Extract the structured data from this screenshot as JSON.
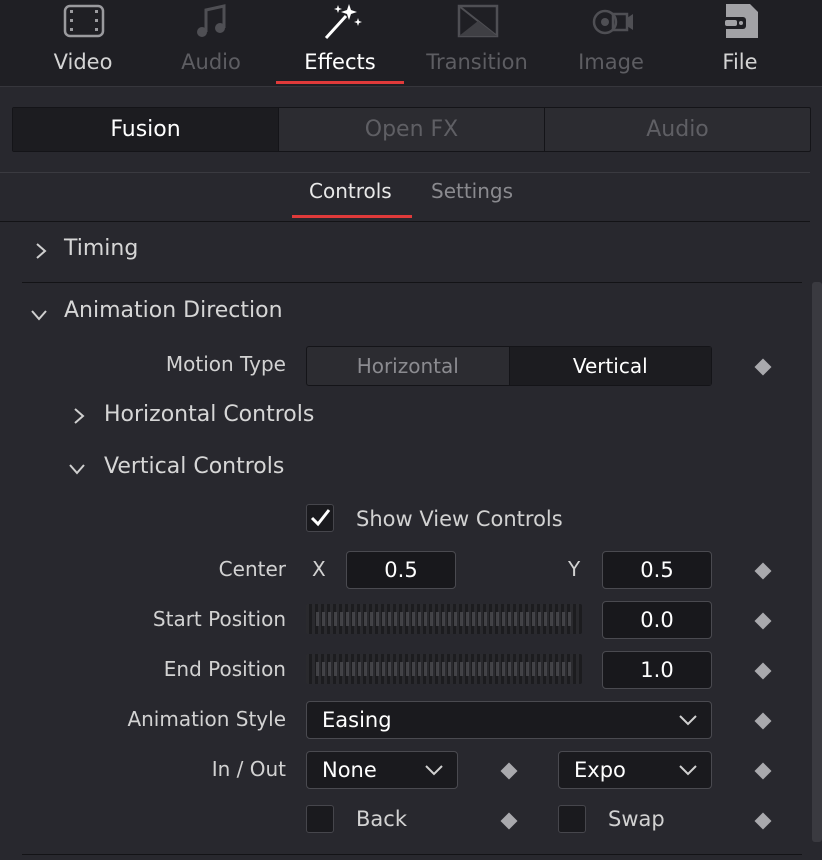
{
  "top_tabs": [
    {
      "label": "Video",
      "icon": "film-icon",
      "state": "normal"
    },
    {
      "label": "Audio",
      "icon": "music-note-icon",
      "state": "dim"
    },
    {
      "label": "Effects",
      "icon": "magic-wand-icon",
      "state": "active"
    },
    {
      "label": "Transition",
      "icon": "transition-icon",
      "state": "dim"
    },
    {
      "label": "Image",
      "icon": "camera-icon",
      "state": "dim"
    },
    {
      "label": "File",
      "icon": "file-icon",
      "state": "normal"
    }
  ],
  "segments": [
    {
      "label": "Fusion",
      "active": true
    },
    {
      "label": "Open FX",
      "active": false
    },
    {
      "label": "Audio",
      "active": false
    }
  ],
  "sub_tabs": {
    "controls": "Controls",
    "settings": "Settings"
  },
  "sections": {
    "timing": "Timing",
    "animation_direction": "Animation Direction",
    "horizontal_controls": "Horizontal Controls",
    "vertical_controls": "Vertical Controls"
  },
  "motion_type": {
    "label": "Motion Type",
    "options": [
      "Horizontal",
      "Vertical"
    ],
    "selected": "Vertical"
  },
  "show_view_controls": {
    "label": "Show View Controls",
    "checked": true
  },
  "center": {
    "label": "Center",
    "x_label": "X",
    "x_value": "0.5",
    "y_label": "Y",
    "y_value": "0.5"
  },
  "start_position": {
    "label": "Start Position",
    "value": "0.0"
  },
  "end_position": {
    "label": "End Position",
    "value": "1.0"
  },
  "animation_style": {
    "label": "Animation Style",
    "value": "Easing"
  },
  "in_out": {
    "label": "In / Out",
    "in_value": "None",
    "out_value": "Expo"
  },
  "back": {
    "label": "Back",
    "checked": false
  },
  "swap": {
    "label": "Swap",
    "checked": false
  },
  "colors": {
    "accent": "#e03a3a",
    "background": "#28282e",
    "field": "#18181c"
  }
}
